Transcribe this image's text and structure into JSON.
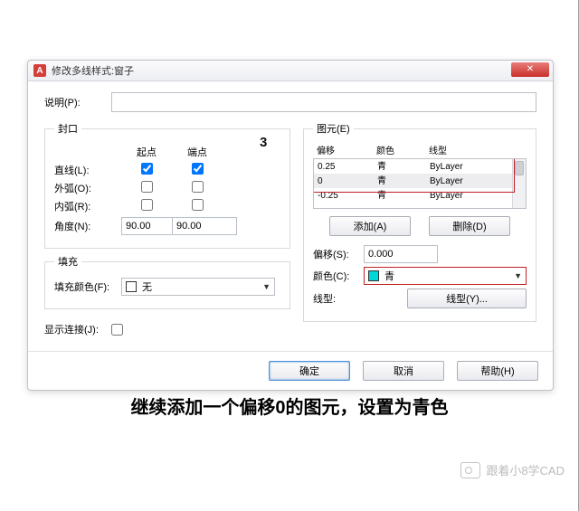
{
  "title": "修改多线样式:窗子",
  "desc_label": "说明(P):",
  "desc_value": "",
  "cap_group": "封口",
  "col_start": "起点",
  "col_end": "端点",
  "line_lbl": "直线(L):",
  "line_s": true,
  "line_e": true,
  "arcout_lbl": "外弧(O):",
  "arcout_s": false,
  "arcout_e": false,
  "arcin_lbl": "内弧(R):",
  "arcin_s": false,
  "arcin_e": false,
  "angle_lbl": "角度(N):",
  "angle_s": "90.00",
  "angle_e": "90.00",
  "fill_group": "填充",
  "fill_lbl": "填充颜色(F):",
  "fill_val": "无",
  "joint_lbl": "显示连接(J):",
  "joint_v": false,
  "elem_group": "图元(E)",
  "hdr_off": "偏移",
  "hdr_col": "颜色",
  "hdr_lt": "线型",
  "rows": [
    {
      "off": "0.25",
      "col": "青",
      "lt": "ByLayer"
    },
    {
      "off": "0",
      "col": "青",
      "lt": "ByLayer"
    },
    {
      "off": "-0.25",
      "col": "青",
      "lt": "ByLayer"
    }
  ],
  "add_btn": "添加(A)",
  "del_btn": "删除(D)",
  "off_lbl": "偏移(S):",
  "off_val": "0.000",
  "color_lbl": "颜色(C):",
  "color_val": "青",
  "lt_lbl": "线型:",
  "lt_btn": "线型(Y)...",
  "ok": "确定",
  "cancel": "取消",
  "help": "帮助(H)",
  "ann3": "3",
  "caption": "继续添加一个偏移0的图元，设置为青色",
  "wm": "跟着小8学CAD"
}
